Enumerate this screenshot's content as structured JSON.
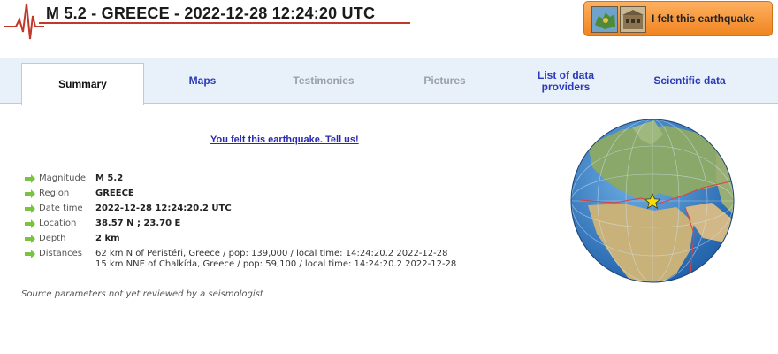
{
  "header": {
    "title": "M 5.2 - GREECE - 2022-12-28 12:24:20 UTC",
    "felt_button_label": "I felt this earthquake"
  },
  "tabs": [
    {
      "label": "Summary",
      "state": "active"
    },
    {
      "label": "Maps",
      "state": "link"
    },
    {
      "label": "Testimonies",
      "state": "disabled"
    },
    {
      "label": "Pictures",
      "state": "disabled"
    },
    {
      "label": "List of data providers",
      "state": "link"
    },
    {
      "label": "Scientific data",
      "state": "link"
    }
  ],
  "summary": {
    "tell_us_link": "You felt this earthquake. Tell us!",
    "magnitude_label": "Magnitude",
    "magnitude_value": "M 5.2",
    "region_label": "Region",
    "region_value": "GREECE",
    "datetime_label": "Date time",
    "datetime_value": "2022-12-28 12:24:20.2 UTC",
    "location_label": "Location",
    "location_value": "38.57 N ; 23.70 E",
    "depth_label": "Depth",
    "depth_value": "2 km",
    "distances_label": "Distances",
    "distance_1": "62 km N of Peristéri, Greece / pop: 139,000 / local time: 14:24:20.2 2022-12-28",
    "distance_2": "15 km NNE of Chalkída, Greece / pop: 59,100 / local time: 14:24:20.2 2022-12-28",
    "note": "Source parameters not yet reviewed by a seismologist"
  },
  "colors": {
    "accent_orange": "#f08420",
    "tab_bar": "#e8f0fa",
    "link_blue": "#2a3ab8",
    "arrow_green": "#7cc242",
    "epicenter_star": "#f5e000"
  }
}
